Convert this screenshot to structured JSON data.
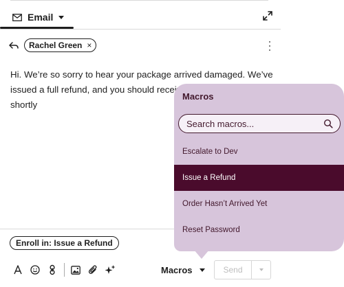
{
  "compose": {
    "channel_tab": "Email",
    "recipient": "Rachel Green",
    "body": "Hi. We’re so sorry to hear your package arrived damaged. We’ve issued a full refund, and you should receive\nshortly",
    "body_line1": "Hi. We’re so sorry to hear your package arrived damaged. We’ve",
    "body_line2": "issued a full refund, and you should receiv",
    "body_line3": "shortly",
    "enroll_label": "Enroll in: Issue a Refund"
  },
  "toolbar": {
    "macros_label": "Macros",
    "send_label": "Send"
  },
  "macros_popover": {
    "title": "Macros",
    "search_placeholder": "Search macros...",
    "items": [
      {
        "label": "Escalate to Dev",
        "selected": false
      },
      {
        "label": "Issue a Refund",
        "selected": true
      },
      {
        "label": "Order Hasn’t Arrived Yet",
        "selected": false
      },
      {
        "label": "Reset Password",
        "selected": false
      }
    ]
  },
  "icons": [
    "envelope-icon",
    "expand-icon",
    "reply-icon",
    "close-icon",
    "more-icon",
    "text-format-icon",
    "emoji-icon",
    "link-icon",
    "image-icon",
    "attachment-icon",
    "sparkle-icon",
    "chevron-down-icon",
    "search-icon"
  ],
  "colors": {
    "popover_bg": "#d7c5db",
    "accent_dark": "#4a0b2c",
    "text_dark": "#42182c"
  }
}
